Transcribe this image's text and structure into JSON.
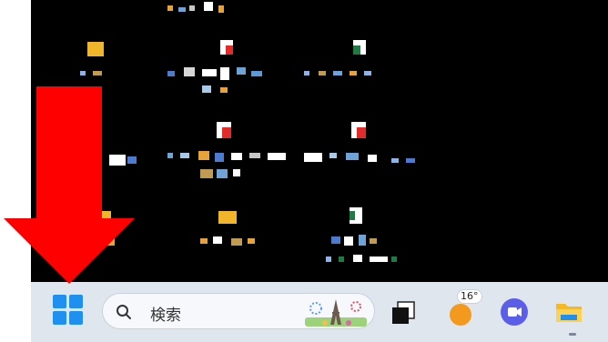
{
  "taskbar": {
    "search_placeholder": "検索",
    "weather_temp": "16°"
  },
  "icons": {
    "start": "windows-start-icon",
    "search": "search-icon",
    "search_highlight": "eiffel-tower-fireworks-icon",
    "task_view": "task-view-icon",
    "weather": "weather-sun-icon",
    "copilot": "chat-app-icon",
    "explorer": "file-explorer-icon"
  },
  "annotation": {
    "arrow_color": "#ff0000"
  },
  "colors": {
    "desktop_bg": "#000000",
    "taskbar_bg": "#dfe6ee",
    "accent": "#1f8ff0"
  }
}
